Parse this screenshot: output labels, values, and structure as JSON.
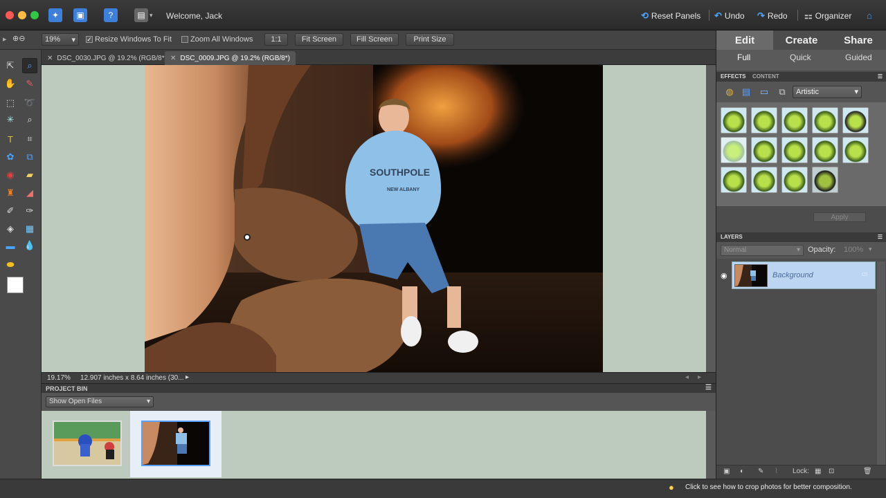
{
  "topbar": {
    "welcome": "Welcome, Jack",
    "reset_panels": "Reset Panels",
    "undo": "Undo",
    "redo": "Redo",
    "organizer": "Organizer"
  },
  "options": {
    "zoom_value": "19%",
    "resize_windows": "Resize Windows To Fit",
    "zoom_all": "Zoom All Windows",
    "one_to_one": "1:1",
    "fit_screen": "Fit Screen",
    "fill_screen": "Fill Screen",
    "print_size": "Print Size"
  },
  "doc_tabs": [
    {
      "label": "DSC_0030.JPG @ 19.2% (RGB/8*)"
    },
    {
      "label": "DSC_0009.JPG @ 19.2% (RGB/8*)"
    }
  ],
  "status": {
    "zoom": "19.17%",
    "doc_size": "12.907 inches x 8.64 inches (30..."
  },
  "project_bin": {
    "title": "PROJECT BIN",
    "dropdown": "Show Open Files"
  },
  "right": {
    "tabs": [
      "Edit",
      "Create",
      "Share"
    ],
    "subtabs": [
      "Full",
      "Quick",
      "Guided"
    ],
    "effects_tab": "EFFECTS",
    "content_tab": "CONTENT",
    "category": "Artistic",
    "apply": "Apply",
    "layers_title": "LAYERS",
    "blend_mode": "Normal",
    "opacity_label": "Opacity:",
    "opacity_value": "100%",
    "layer_name": "Background",
    "lock_label": "Lock:"
  },
  "bottom": {
    "hint": "Click to see how to crop photos for better composition."
  },
  "photo_text": {
    "shirt_line1": "SOUTHPOLE",
    "shirt_line2": "NEW ALBANY"
  }
}
